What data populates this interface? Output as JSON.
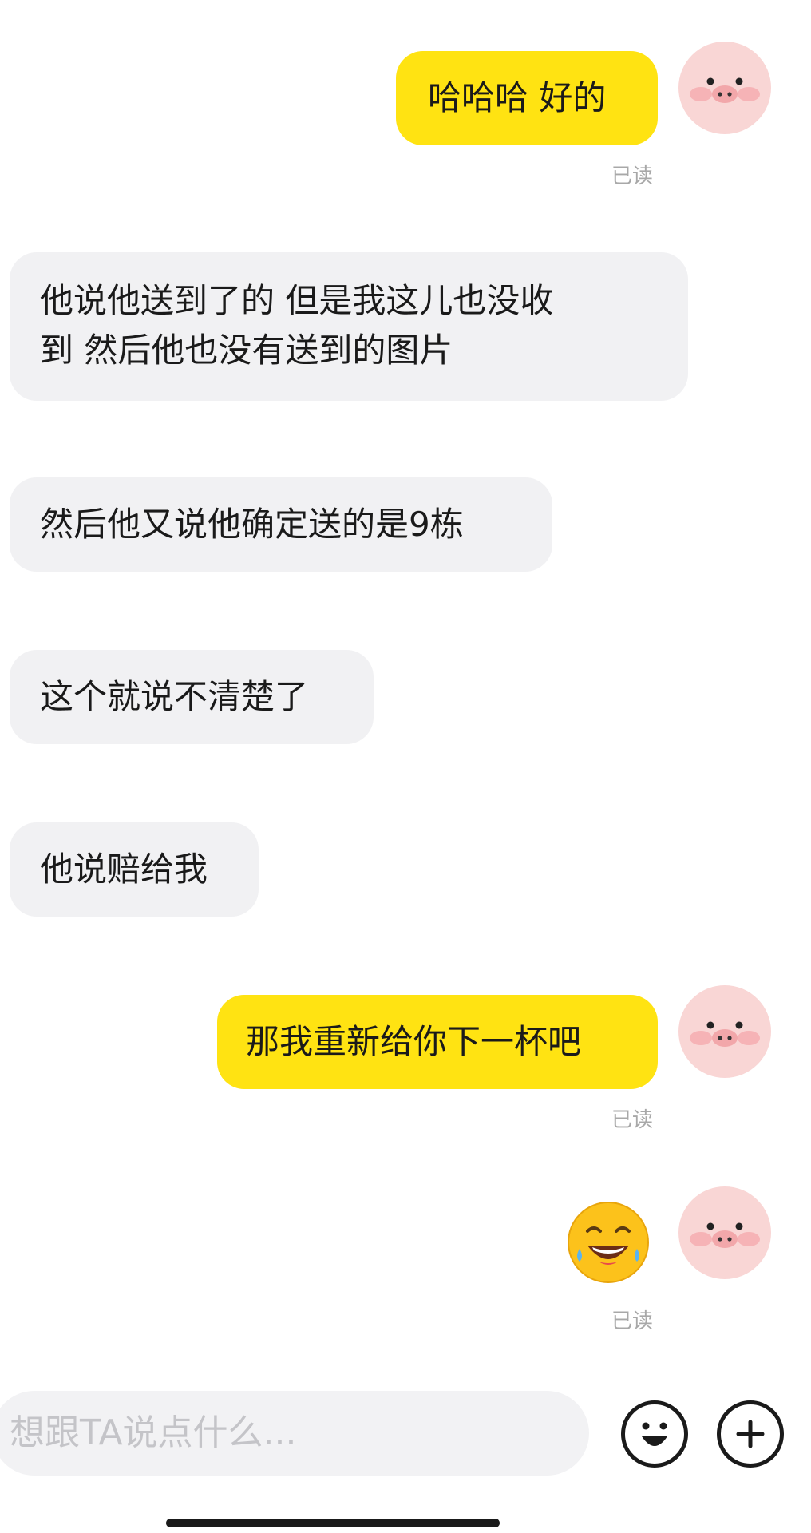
{
  "messages": [
    {
      "side": "mine",
      "text": "哈哈哈 好的",
      "status": "已读"
    },
    {
      "side": "theirs",
      "lines": [
        "他说他送到了的 但是我这儿也没收",
        "到 然后他也没有送到的图片"
      ]
    },
    {
      "side": "theirs",
      "text": "然后他又说他确定送的是9栋"
    },
    {
      "side": "theirs",
      "text": "这个就说不清楚了"
    },
    {
      "side": "theirs",
      "text": "他说赔给我"
    },
    {
      "side": "mine",
      "text": "那我重新给你下一杯吧",
      "status": "已读"
    },
    {
      "side": "mine",
      "emoji": "laughing-crying-emoji",
      "status": "已读"
    }
  ],
  "avatar_icon": "pig-face-avatar",
  "composer": {
    "placeholder": "想跟TA说点什么...",
    "emoji_button_icon": "smiley-icon",
    "plus_button_icon": "plus-icon"
  },
  "colors": {
    "my_bubble": "#ffe312",
    "their_bubble": "#f1f1f3",
    "avatar_bg": "#f9d6d5"
  }
}
